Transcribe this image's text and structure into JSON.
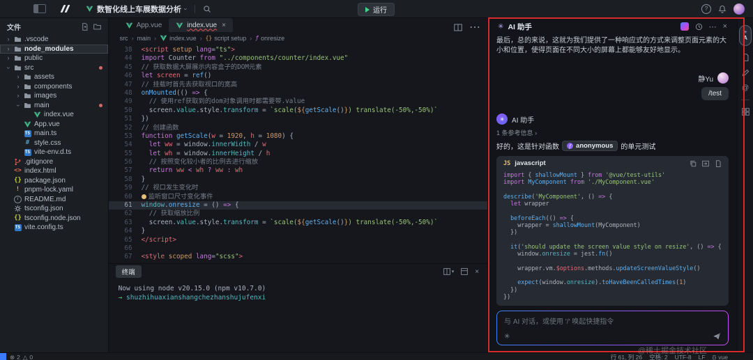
{
  "topbar": {
    "project_title": "数智化线上车展数据分析",
    "run_label": "运行"
  },
  "explorer": {
    "title": "文件",
    "items": [
      {
        "label": ".vscode",
        "depth": 0,
        "kind": "folder",
        "expanded": false
      },
      {
        "label": "node_modules",
        "depth": 0,
        "kind": "folder",
        "expanded": false,
        "highlighted": true
      },
      {
        "label": "public",
        "depth": 0,
        "kind": "folder",
        "expanded": false
      },
      {
        "label": "src",
        "depth": 0,
        "kind": "folder",
        "expanded": true,
        "dot": true
      },
      {
        "label": "assets",
        "depth": 1,
        "kind": "folder",
        "expanded": false
      },
      {
        "label": "components",
        "depth": 1,
        "kind": "folder",
        "expanded": false
      },
      {
        "label": "images",
        "depth": 1,
        "kind": "folder",
        "expanded": false
      },
      {
        "label": "main",
        "depth": 1,
        "kind": "folder",
        "expanded": true,
        "dot": true
      },
      {
        "label": "index.vue",
        "depth": 2,
        "kind": "vue",
        "error": true
      },
      {
        "label": "App.vue",
        "depth": 1,
        "kind": "vue"
      },
      {
        "label": "main.ts",
        "depth": 1,
        "kind": "ts"
      },
      {
        "label": "style.css",
        "depth": 1,
        "kind": "css"
      },
      {
        "label": "vite-env.d.ts",
        "depth": 1,
        "kind": "ts"
      },
      {
        "label": ".gitignore",
        "depth": 0,
        "kind": "git"
      },
      {
        "label": "index.html",
        "depth": 0,
        "kind": "html"
      },
      {
        "label": "package.json",
        "depth": 0,
        "kind": "json"
      },
      {
        "label": "pnpm-lock.yaml",
        "depth": 0,
        "kind": "yaml"
      },
      {
        "label": "README.md",
        "depth": 0,
        "kind": "md"
      },
      {
        "label": "tsconfig.json",
        "depth": 0,
        "kind": "gear"
      },
      {
        "label": "tsconfig.node.json",
        "depth": 0,
        "kind": "json"
      },
      {
        "label": "vite.config.ts",
        "depth": 0,
        "kind": "ts"
      }
    ]
  },
  "editor": {
    "tabs": [
      {
        "label": "App.vue"
      },
      {
        "label": "index.vue"
      }
    ],
    "breadcrumb": [
      {
        "label": "src",
        "icon": ""
      },
      {
        "label": "main",
        "icon": ""
      },
      {
        "label": "index.vue",
        "icon": "vue"
      },
      {
        "label": "script setup",
        "icon": "braces"
      },
      {
        "label": "onresize",
        "icon": "symbol-event"
      }
    ],
    "code_lines": [
      {
        "n": "38",
        "t": [
          [
            "tg",
            "<script"
          ],
          [
            "at",
            " setup"
          ],
          [
            "kw",
            " lang"
          ],
          [
            "pl",
            "="
          ],
          [
            "st",
            "\"ts\""
          ],
          [
            "tg",
            ">"
          ]
        ]
      },
      {
        "n": "44",
        "t": [
          [
            "kw",
            "import"
          ],
          [
            "pl",
            " Counter "
          ],
          [
            "kw",
            "from"
          ],
          [
            "st",
            " \"../components/counter/index.vue\""
          ]
        ]
      },
      {
        "n": "45",
        "t": [
          [
            "cm",
            "// 获取数据大屏展示内容盒子的DOM元素"
          ]
        ]
      },
      {
        "n": "46",
        "t": [
          [
            "kw",
            "let"
          ],
          [
            "vr",
            " screen"
          ],
          [
            "pl",
            " = "
          ],
          [
            "fn",
            "ref"
          ],
          [
            "pl",
            "()"
          ]
        ]
      },
      {
        "n": "47",
        "t": [
          [
            "cm",
            "// 挂载时首先去获取视口的宽高"
          ]
        ]
      },
      {
        "n": "48",
        "t": [
          [
            "fn",
            "onMounted"
          ],
          [
            "pl",
            "(() "
          ],
          [
            "kw",
            "=>"
          ],
          [
            "pl",
            " {"
          ]
        ]
      },
      {
        "n": "49",
        "t": [
          [
            "cm",
            "  // 使用ref获取到的dom对象调用时都需要带.value"
          ]
        ]
      },
      {
        "n": "50",
        "t": [
          [
            "pl",
            "  screen."
          ],
          [
            "cy",
            "value"
          ],
          [
            "pl",
            ".style."
          ],
          [
            "cy",
            "transform"
          ],
          [
            "pl",
            " = "
          ],
          [
            "st",
            "`scale("
          ],
          [
            "at",
            "${"
          ],
          [
            "fn",
            "getScale"
          ],
          [
            "pl",
            "()"
          ],
          [
            "at",
            "}"
          ],
          [
            "st",
            ") translate(-50%,-50%)`"
          ]
        ]
      },
      {
        "n": "51",
        "t": [
          [
            "pl",
            "})"
          ]
        ]
      },
      {
        "n": "52",
        "t": [
          [
            "cm",
            "// 创建函数"
          ]
        ]
      },
      {
        "n": "53",
        "t": [
          [
            "kw",
            "function"
          ],
          [
            "fn",
            " getScale"
          ],
          [
            "pl",
            "("
          ],
          [
            "vr",
            "w"
          ],
          [
            "pl",
            " = "
          ],
          [
            "nm",
            "1920"
          ],
          [
            "pl",
            ", "
          ],
          [
            "vr",
            "h"
          ],
          [
            "pl",
            " = "
          ],
          [
            "nm",
            "1080"
          ],
          [
            "pl",
            ") {"
          ]
        ]
      },
      {
        "n": "54",
        "t": [
          [
            "kw",
            "  let"
          ],
          [
            "vr",
            " ww"
          ],
          [
            "pl",
            " = window."
          ],
          [
            "cy",
            "innerWidth"
          ],
          [
            "pl",
            " / "
          ],
          [
            "vr",
            "w"
          ]
        ]
      },
      {
        "n": "55",
        "t": [
          [
            "kw",
            "  let"
          ],
          [
            "vr",
            " wh"
          ],
          [
            "pl",
            " = window."
          ],
          [
            "cy",
            "innerHeight"
          ],
          [
            "pl",
            " / "
          ],
          [
            "vr",
            "h"
          ]
        ]
      },
      {
        "n": "56",
        "t": [
          [
            "cm",
            "  // 按照变化较小者的比例去进行缩放"
          ]
        ]
      },
      {
        "n": "57",
        "t": [
          [
            "kw",
            "  return"
          ],
          [
            "vr",
            " ww"
          ],
          [
            "kw",
            " < "
          ],
          [
            "vr",
            "wh"
          ],
          [
            "kw",
            " ? "
          ],
          [
            "vr",
            "ww"
          ],
          [
            "kw",
            " : "
          ],
          [
            "vr",
            "wh"
          ]
        ]
      },
      {
        "n": "58",
        "t": [
          [
            "pl",
            "}"
          ]
        ]
      },
      {
        "n": "59",
        "t": [
          [
            "cm",
            "// 视口发生变化时"
          ]
        ]
      },
      {
        "n": "60",
        "t": [
          [
            "bulb",
            ""
          ],
          [
            "cm",
            "监听窗口尺寸变化事件"
          ]
        ]
      },
      {
        "n": "61",
        "current": true,
        "t": [
          [
            "cy",
            "window"
          ],
          [
            "pl",
            "."
          ],
          [
            "fn",
            "onresize"
          ],
          [
            "pl",
            " = () "
          ],
          [
            "kw",
            "=>"
          ],
          [
            "pl",
            " {"
          ]
        ]
      },
      {
        "n": "62",
        "t": [
          [
            "cm",
            "  // 获取缩放比例"
          ]
        ]
      },
      {
        "n": "63",
        "t": [
          [
            "pl",
            "  screen."
          ],
          [
            "cy",
            "value"
          ],
          [
            "pl",
            ".style."
          ],
          [
            "cy",
            "transform"
          ],
          [
            "pl",
            " = "
          ],
          [
            "st",
            "`scale("
          ],
          [
            "at",
            "${"
          ],
          [
            "fn",
            "getScale"
          ],
          [
            "pl",
            "()"
          ],
          [
            "at",
            "}"
          ],
          [
            "st",
            ") translate(-50%,-50%)`"
          ]
        ]
      },
      {
        "n": "64",
        "t": [
          [
            "pl",
            "}"
          ]
        ]
      },
      {
        "n": "65",
        "t": [
          [
            "tg",
            "</script>"
          ]
        ]
      },
      {
        "n": "66",
        "t": []
      },
      {
        "n": "67",
        "t": [
          [
            "tg",
            "<style"
          ],
          [
            "at",
            " scoped"
          ],
          [
            "kw",
            " lang"
          ],
          [
            "pl",
            "="
          ],
          [
            "st",
            "\"scss\""
          ],
          [
            "tg",
            ">"
          ]
        ]
      }
    ]
  },
  "terminal": {
    "tab_label": "终端",
    "lines": [
      [
        [
          "pl",
          "Now using node v20.15.0 (npm v10.7.0)"
        ]
      ],
      [
        [
          "ar",
          "→ "
        ],
        [
          "lk",
          "shuzhihuaxianshangchezhanshujufenxi"
        ]
      ]
    ]
  },
  "ai_panel": {
    "title": "AI 助手",
    "previous_message": "最后，总的来说，这就为我们提供了一种响应式的方式来调整页面元素的大小和位置，使得页面在不同大小的屏幕上都能够友好地显示。",
    "user": {
      "name": "静Yu",
      "message": "/test"
    },
    "assistant": {
      "name": "AI 助手",
      "reference": "1 条参考信息",
      "answer_prefix": "好的，这是针对函数",
      "function_badge": "anonymous",
      "answer_suffix": "的单元测试"
    },
    "code_block": {
      "lang_badge": "JS",
      "lang": "javascript",
      "lines": [
        [
          [
            "kw",
            "import"
          ],
          [
            "pl",
            " { "
          ],
          [
            "fn",
            "shallowMount"
          ],
          [
            "pl",
            " } "
          ],
          [
            "kw",
            "from"
          ],
          [
            "st",
            " '@vue/test-utils'"
          ]
        ],
        [
          [
            "kw",
            "import"
          ],
          [
            "fn",
            " MyComponent"
          ],
          [
            "kw",
            " from"
          ],
          [
            "st",
            " './MyComponent.vue'"
          ]
        ],
        [],
        [
          [
            "fn",
            "describe"
          ],
          [
            "pl",
            "("
          ],
          [
            "st",
            "'MyComponent'"
          ],
          [
            "pl",
            ", () "
          ],
          [
            "kw",
            "=>"
          ],
          [
            "pl",
            " {"
          ]
        ],
        [
          [
            "kw",
            "  let"
          ],
          [
            "pl",
            " wrapper"
          ]
        ],
        [],
        [
          [
            "fn",
            "  beforeEach"
          ],
          [
            "pl",
            "(() "
          ],
          [
            "kw",
            "=>"
          ],
          [
            "pl",
            " {"
          ]
        ],
        [
          [
            "pl",
            "    wrapper = "
          ],
          [
            "fn",
            "shallowMount"
          ],
          [
            "pl",
            "(MyComponent)"
          ]
        ],
        [
          [
            "pl",
            "  })"
          ]
        ],
        [],
        [
          [
            "fn",
            "  it"
          ],
          [
            "pl",
            "("
          ],
          [
            "st",
            "'should update the screen value style on resize'"
          ],
          [
            "pl",
            ", () "
          ],
          [
            "kw",
            "=>"
          ],
          [
            "pl",
            " {"
          ]
        ],
        [
          [
            "pl",
            "    window."
          ],
          [
            "cy",
            "onresize"
          ],
          [
            "pl",
            " = jest."
          ],
          [
            "fn",
            "fn"
          ],
          [
            "pl",
            "()"
          ]
        ],
        [],
        [
          [
            "pl",
            "    wrapper.vm."
          ],
          [
            "vr",
            "$options"
          ],
          [
            "pl",
            ".methods."
          ],
          [
            "fn",
            "updateScreenValueStyle"
          ],
          [
            "pl",
            "()"
          ]
        ],
        [],
        [
          [
            "fn",
            "    expect"
          ],
          [
            "pl",
            "(window."
          ],
          [
            "cy",
            "onresize"
          ],
          [
            "pl",
            ")."
          ],
          [
            "fn",
            "toHaveBeenCalledTimes"
          ],
          [
            "pl",
            "("
          ],
          [
            "nm",
            "1"
          ],
          [
            "pl",
            ")"
          ]
        ],
        [
          [
            "pl",
            "  })"
          ]
        ],
        [
          [
            "pl",
            "})"
          ]
        ]
      ]
    },
    "input_placeholder": "与 AI 对话，或使用 '/' 唤起快捷指令"
  },
  "statusbar": {
    "errors": "2",
    "warnings": "0",
    "cursor": "行 61, 列 26",
    "indent": "空格: 2",
    "encoding": "UTF-8",
    "eol": "LF",
    "language": "vue"
  },
  "watermark": "@稀土掘金技术社区"
}
